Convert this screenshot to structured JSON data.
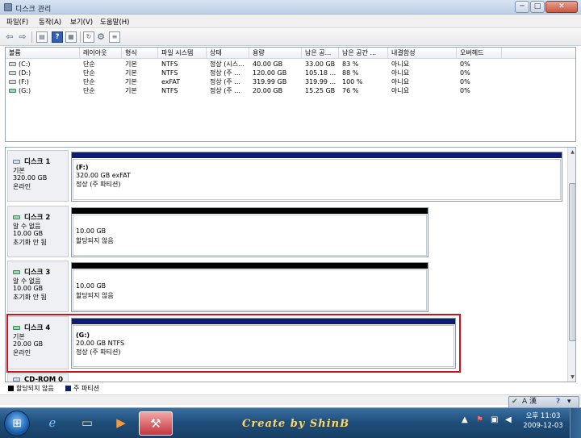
{
  "window": {
    "title": "디스크 관리",
    "controls": {
      "minimize": "─",
      "maximize": "□",
      "close": "✕"
    }
  },
  "menu": [
    "파일(F)",
    "동작(A)",
    "보기(V)",
    "도움말(H)"
  ],
  "toolbar": {
    "icons": [
      "back-arrow-icon",
      "forward-arrow-icon",
      "console-tree-icon",
      "help-icon",
      "properties-icon",
      "refresh-icon",
      "settings-icon",
      "export-list-icon"
    ]
  },
  "volume_list": {
    "columns": [
      "볼륨",
      "레이아웃",
      "형식",
      "파일 시스템",
      "상태",
      "용량",
      "남은 공...",
      "남은 공간 ...",
      "내결함성",
      "오버헤드"
    ],
    "rows": [
      {
        "volume": "(C:)",
        "layout": "단순",
        "type": "기본",
        "fs": "NTFS",
        "status": "정상 (시스...",
        "capacity": "40.00 GB",
        "free": "33.00 GB",
        "free_pct": "83 %",
        "fault": "아니요",
        "overhead": "0%"
      },
      {
        "volume": "(D:)",
        "layout": "단순",
        "type": "기본",
        "fs": "NTFS",
        "status": "정상 (주 ...",
        "capacity": "120.00 GB",
        "free": "105.18 ...",
        "free_pct": "88 %",
        "fault": "아니요",
        "overhead": "0%"
      },
      {
        "volume": "(F:)",
        "layout": "단순",
        "type": "기본",
        "fs": "exFAT",
        "status": "정상 (주 ...",
        "capacity": "319.99 GB",
        "free": "319.99 ...",
        "free_pct": "100 %",
        "fault": "아니요",
        "overhead": "0%"
      },
      {
        "volume": "(G:)",
        "layout": "단순",
        "type": "기본",
        "fs": "NTFS",
        "status": "정상 (주 ...",
        "capacity": "20.00 GB",
        "free": "15.25 GB",
        "free_pct": "76 %",
        "fault": "아니요",
        "overhead": "0%"
      }
    ]
  },
  "disks": [
    {
      "name": "디스크 1",
      "type": "기본",
      "size": "320.00 GB",
      "state": "온라인",
      "partition": {
        "label": "(F:)",
        "detail": "320.00 GB exFAT",
        "status": "정상 (주 파티션)"
      }
    },
    {
      "name": "디스크 2",
      "type": "알 수 없음",
      "size": "10.00 GB",
      "state": "초기화 안 됨",
      "partition": {
        "detail": "10.00 GB",
        "status": "할당되지 않음"
      }
    },
    {
      "name": "디스크 3",
      "type": "알 수 없음",
      "size": "10.00 GB",
      "state": "초기화 안 됨",
      "partition": {
        "detail": "10.00 GB",
        "status": "할당되지 않음"
      }
    },
    {
      "name": "디스크 4",
      "type": "기본",
      "size": "20.00 GB",
      "state": "온라인",
      "partition": {
        "label": "(G:)",
        "detail": "20.00 GB NTFS",
        "status": "정상 (주 파티션)"
      }
    },
    {
      "name": "CD-ROM 0"
    }
  ],
  "legend": {
    "unallocated": "할당되지 않음",
    "primary": "주 파티션"
  },
  "colors": {
    "primary_partition": "#0c1d77",
    "unallocated": "#000000",
    "highlight_border": "#c8141a"
  },
  "taskbar": {
    "credit": "Create by ShinB",
    "language": "A 漢",
    "clock_time": "오후 11:03",
    "clock_date": "2009-12-03"
  }
}
